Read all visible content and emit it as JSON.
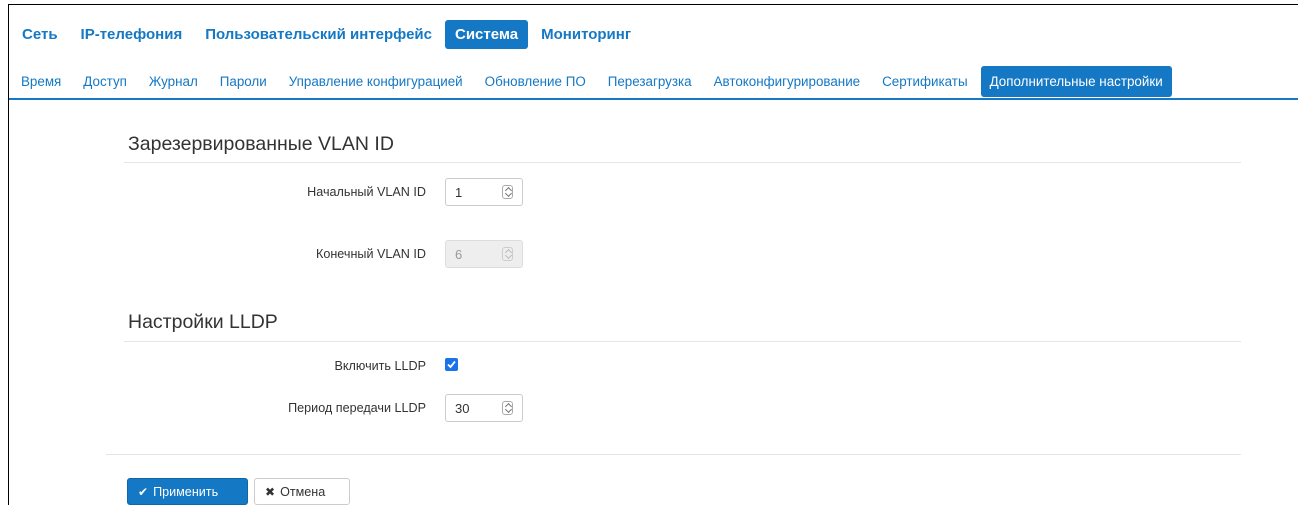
{
  "top_nav": [
    {
      "label": "Сеть",
      "active": false
    },
    {
      "label": "IP-телефония",
      "active": false
    },
    {
      "label": "Пользовательский интерфейс",
      "active": false
    },
    {
      "label": "Система",
      "active": true
    },
    {
      "label": "Мониторинг",
      "active": false
    }
  ],
  "sub_nav": [
    {
      "label": "Время",
      "active": false
    },
    {
      "label": "Доступ",
      "active": false
    },
    {
      "label": "Журнал",
      "active": false
    },
    {
      "label": "Пароли",
      "active": false
    },
    {
      "label": "Управление конфигурацией",
      "active": false
    },
    {
      "label": "Обновление ПО",
      "active": false
    },
    {
      "label": "Перезагрузка",
      "active": false
    },
    {
      "label": "Автоконфигурирование",
      "active": false
    },
    {
      "label": "Сертификаты",
      "active": false
    },
    {
      "label": "Дополнительные настройки",
      "active": true
    }
  ],
  "vlan": {
    "title": "Зарезервированные VLAN ID",
    "start_label": "Начальный VLAN ID",
    "start_value": "1",
    "end_label": "Конечный VLAN ID",
    "end_value": "6"
  },
  "lldp": {
    "title": "Настройки LLDP",
    "enable_label": "Включить LLDP",
    "enabled": true,
    "period_label": "Период передачи LLDP",
    "period_value": "30"
  },
  "buttons": {
    "apply_label": "Применить",
    "cancel_label": "Отмена"
  },
  "colors": {
    "accent": "#1478c4",
    "checkbox": "#1a73e8"
  }
}
